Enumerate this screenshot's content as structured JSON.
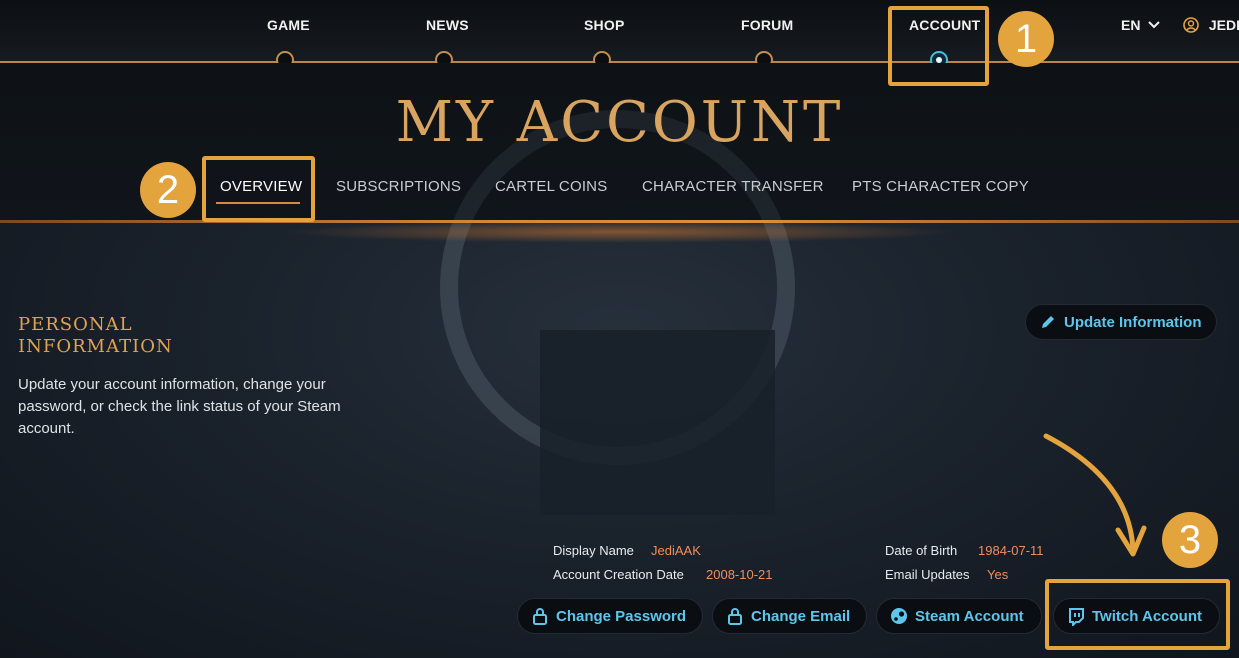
{
  "nav": {
    "items": [
      {
        "label": "GAME"
      },
      {
        "label": "NEWS"
      },
      {
        "label": "SHOP"
      },
      {
        "label": "FORUM"
      },
      {
        "label": "ACCOUNT"
      }
    ],
    "active": "ACCOUNT",
    "language": "EN",
    "user": "JEDIA"
  },
  "page_title": "MY ACCOUNT",
  "tabs": [
    {
      "label": "OVERVIEW"
    },
    {
      "label": "SUBSCRIPTIONS"
    },
    {
      "label": "CARTEL COINS"
    },
    {
      "label": "CHARACTER TRANSFER"
    },
    {
      "label": "PTS CHARACTER COPY"
    }
  ],
  "section": {
    "title_line1": "PERSONAL",
    "title_line2": "INFORMATION",
    "description": "Update your account information, change your password, or check the link status of your Steam account."
  },
  "update_button": "Update Information",
  "info": {
    "display_name_label": "Display Name",
    "display_name": "JediAAK",
    "creation_label": "Account Creation Date",
    "creation_date": "2008-10-21",
    "dob_label": "Date of Birth",
    "dob": "1984-07-11",
    "email_updates_label": "Email Updates",
    "email_updates": "Yes"
  },
  "actions": {
    "change_password": "Change Password",
    "change_email": "Change Email",
    "steam_account": "Steam Account",
    "twitch_account": "Twitch Account"
  },
  "callouts": [
    "1",
    "2",
    "3"
  ],
  "colors": {
    "accent_gold": "#e3a33d",
    "link_cyan": "#5ec6ea",
    "value_orange": "#f08e5c"
  }
}
